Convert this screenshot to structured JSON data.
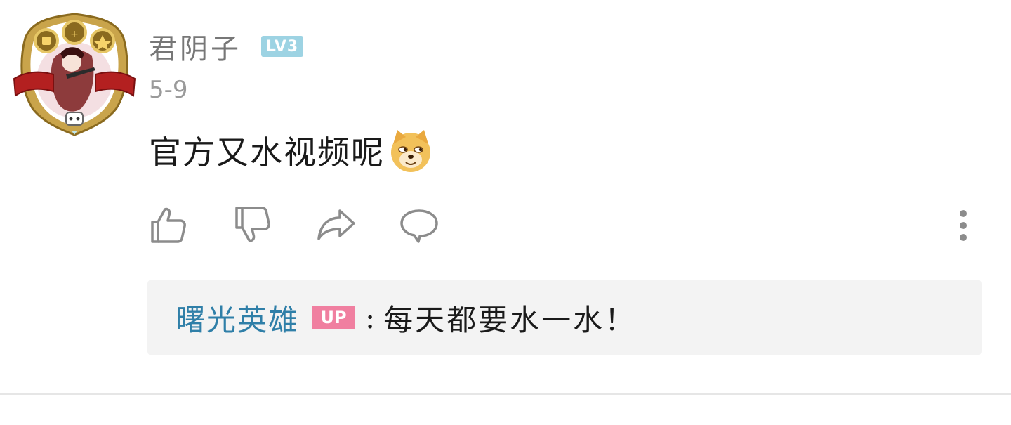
{
  "comment": {
    "username": "君阴子",
    "level_badge": "LV3",
    "date": "5-9",
    "content": "官方又水视频呢",
    "emoji": "doge-emoji",
    "actions": {
      "like_icon": "thumbs-up-icon",
      "dislike_icon": "thumbs-down-icon",
      "share_icon": "share-icon",
      "reply_icon": "comment-bubble-icon",
      "more_icon": "more-vertical-icon"
    }
  },
  "reply": {
    "username": "曙光英雄",
    "badge": "UP",
    "colon": ":",
    "text": "每天都要水一水！"
  },
  "colors": {
    "level_badge": "#9dd3e3",
    "up_badge": "#f07fa0",
    "reply_username": "#2f7fa8",
    "reply_background": "#f3f3f3",
    "muted_text": "#9a9a9a"
  }
}
